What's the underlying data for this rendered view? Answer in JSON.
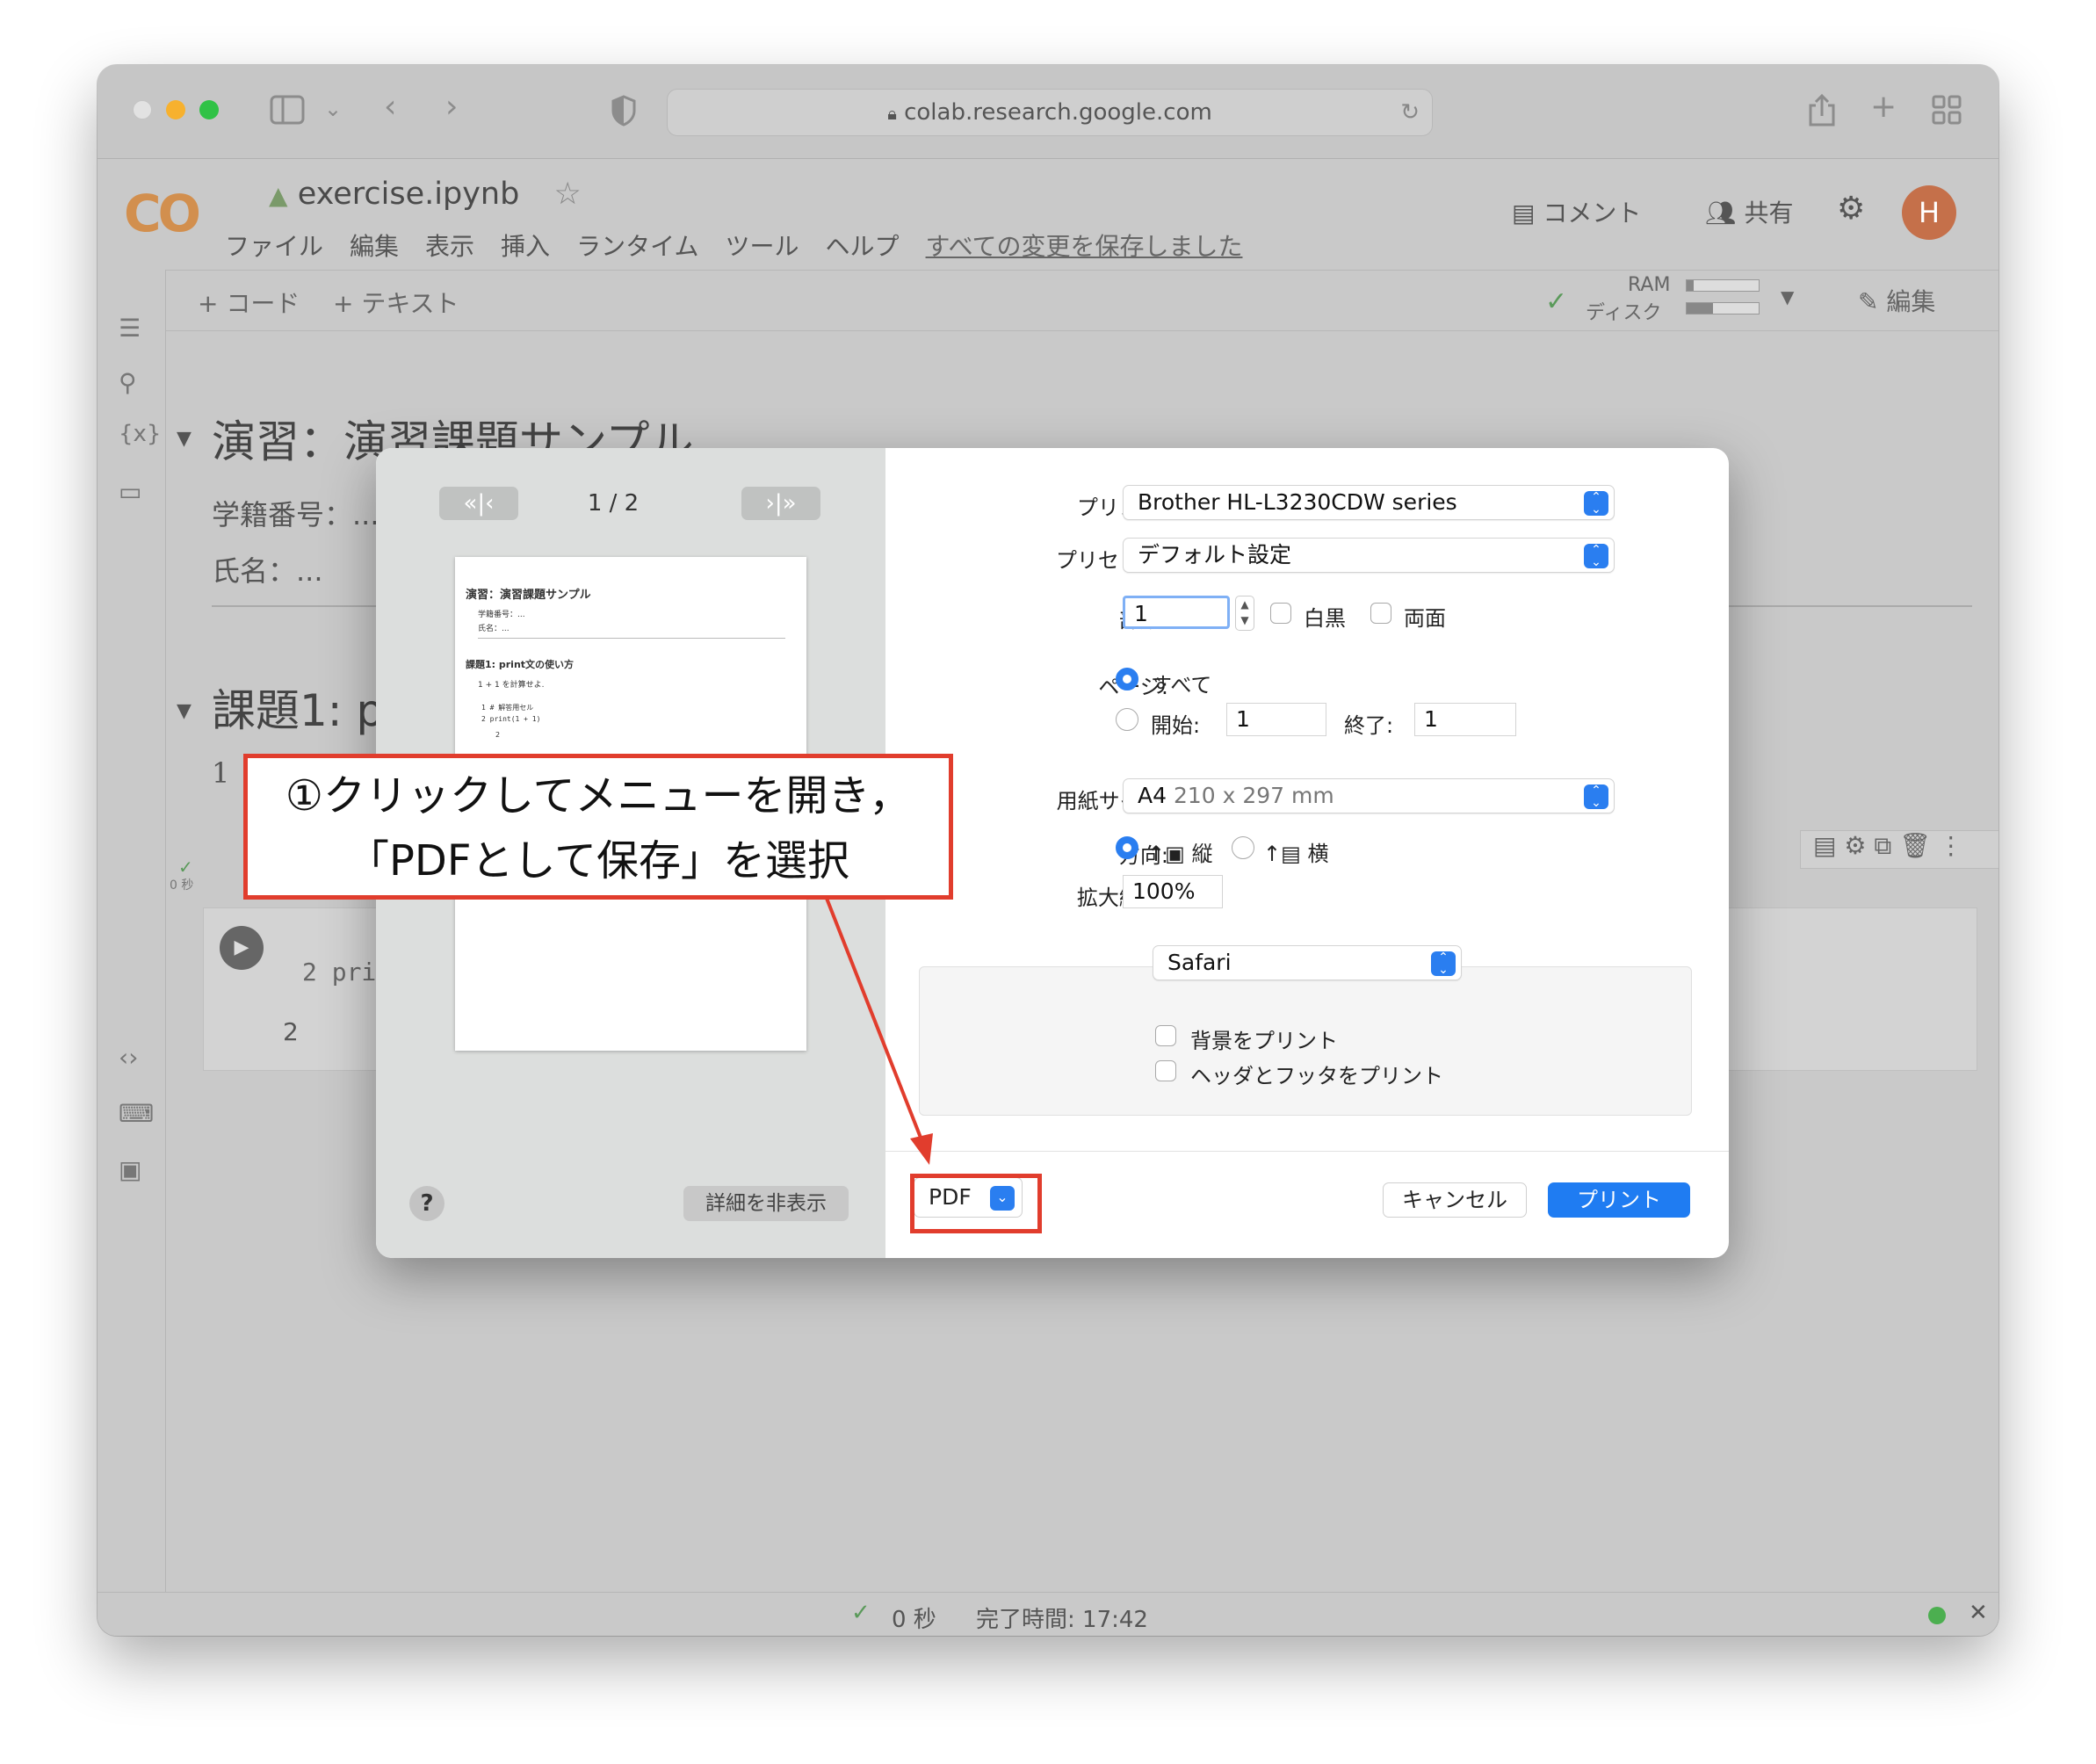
{
  "browser": {
    "url": "colab.research.google.com"
  },
  "colab": {
    "logo": "CO",
    "file_name": "exercise.ipynb",
    "menu": [
      "ファイル",
      "編集",
      "表示",
      "挿入",
      "ランタイム",
      "ツール",
      "ヘルプ"
    ],
    "saved_status": "すべての変更を保存しました",
    "comment_label": "コメント",
    "share_label": "共有",
    "avatar": "H",
    "toolbar": {
      "add_code": "+ コード",
      "add_text": "+ テキスト",
      "ram": "RAM",
      "disk": "ディスク",
      "edit": "編集"
    },
    "notebook": {
      "heading1": "演習：演習課題サンプル",
      "student_id": "学籍番号：...",
      "name": "氏名：...",
      "heading2": "課題1: print文の使い方",
      "line_num": "1",
      "code_line": "2 pri",
      "output": "2",
      "exec_time": "0 秒"
    },
    "status": {
      "time": "0 秒",
      "completed": "完了時間: 17:42"
    }
  },
  "print_dialog": {
    "page_counter": "1 / 2",
    "preview": {
      "h1": "演習：演習課題サンプル",
      "student_id": "学籍番号：...",
      "name": "氏名：...",
      "h2": "課題1: print文の使い方",
      "instruction": "1 + 1 を計算せよ.",
      "code1": "1 # 解答用セル",
      "code2": "2 print(1 + 1)",
      "output": "2"
    },
    "printer_label": "プリンタ:",
    "printer_value": "Brother HL-L3230CDW series",
    "preset_label": "プリセット:",
    "preset_value": "デフォルト設定",
    "copies_label": "部数:",
    "copies_value": "1",
    "bw_label": "白黒",
    "duplex_label": "両面",
    "pages_label": "ページ:",
    "pages_all": "すべて",
    "from_label": "開始:",
    "from_value": "1",
    "to_label": "終了:",
    "to_value": "1",
    "paper_label": "用紙サイズ:",
    "paper_value": "A4",
    "paper_dims": "210 x 297 mm",
    "orientation_label": "方向:",
    "portrait": "縦",
    "landscape": "横",
    "scale_label": "拡大縮小:",
    "scale_value": "100%",
    "app_select": "Safari",
    "bg_print": "背景をプリント",
    "header_footer": "ヘッダとフッタをプリント",
    "help": "?",
    "hide_details": "詳細を非表示",
    "pdf": "PDF",
    "cancel": "キャンセル",
    "print": "プリント"
  },
  "annotation": {
    "line1": "①クリックしてメニューを開き，",
    "line2": "「PDFとして保存」を選択"
  },
  "colors": {
    "accent": "#1f7cf2",
    "callout": "#e13d2d",
    "colab_orange": "#d28f4e"
  }
}
